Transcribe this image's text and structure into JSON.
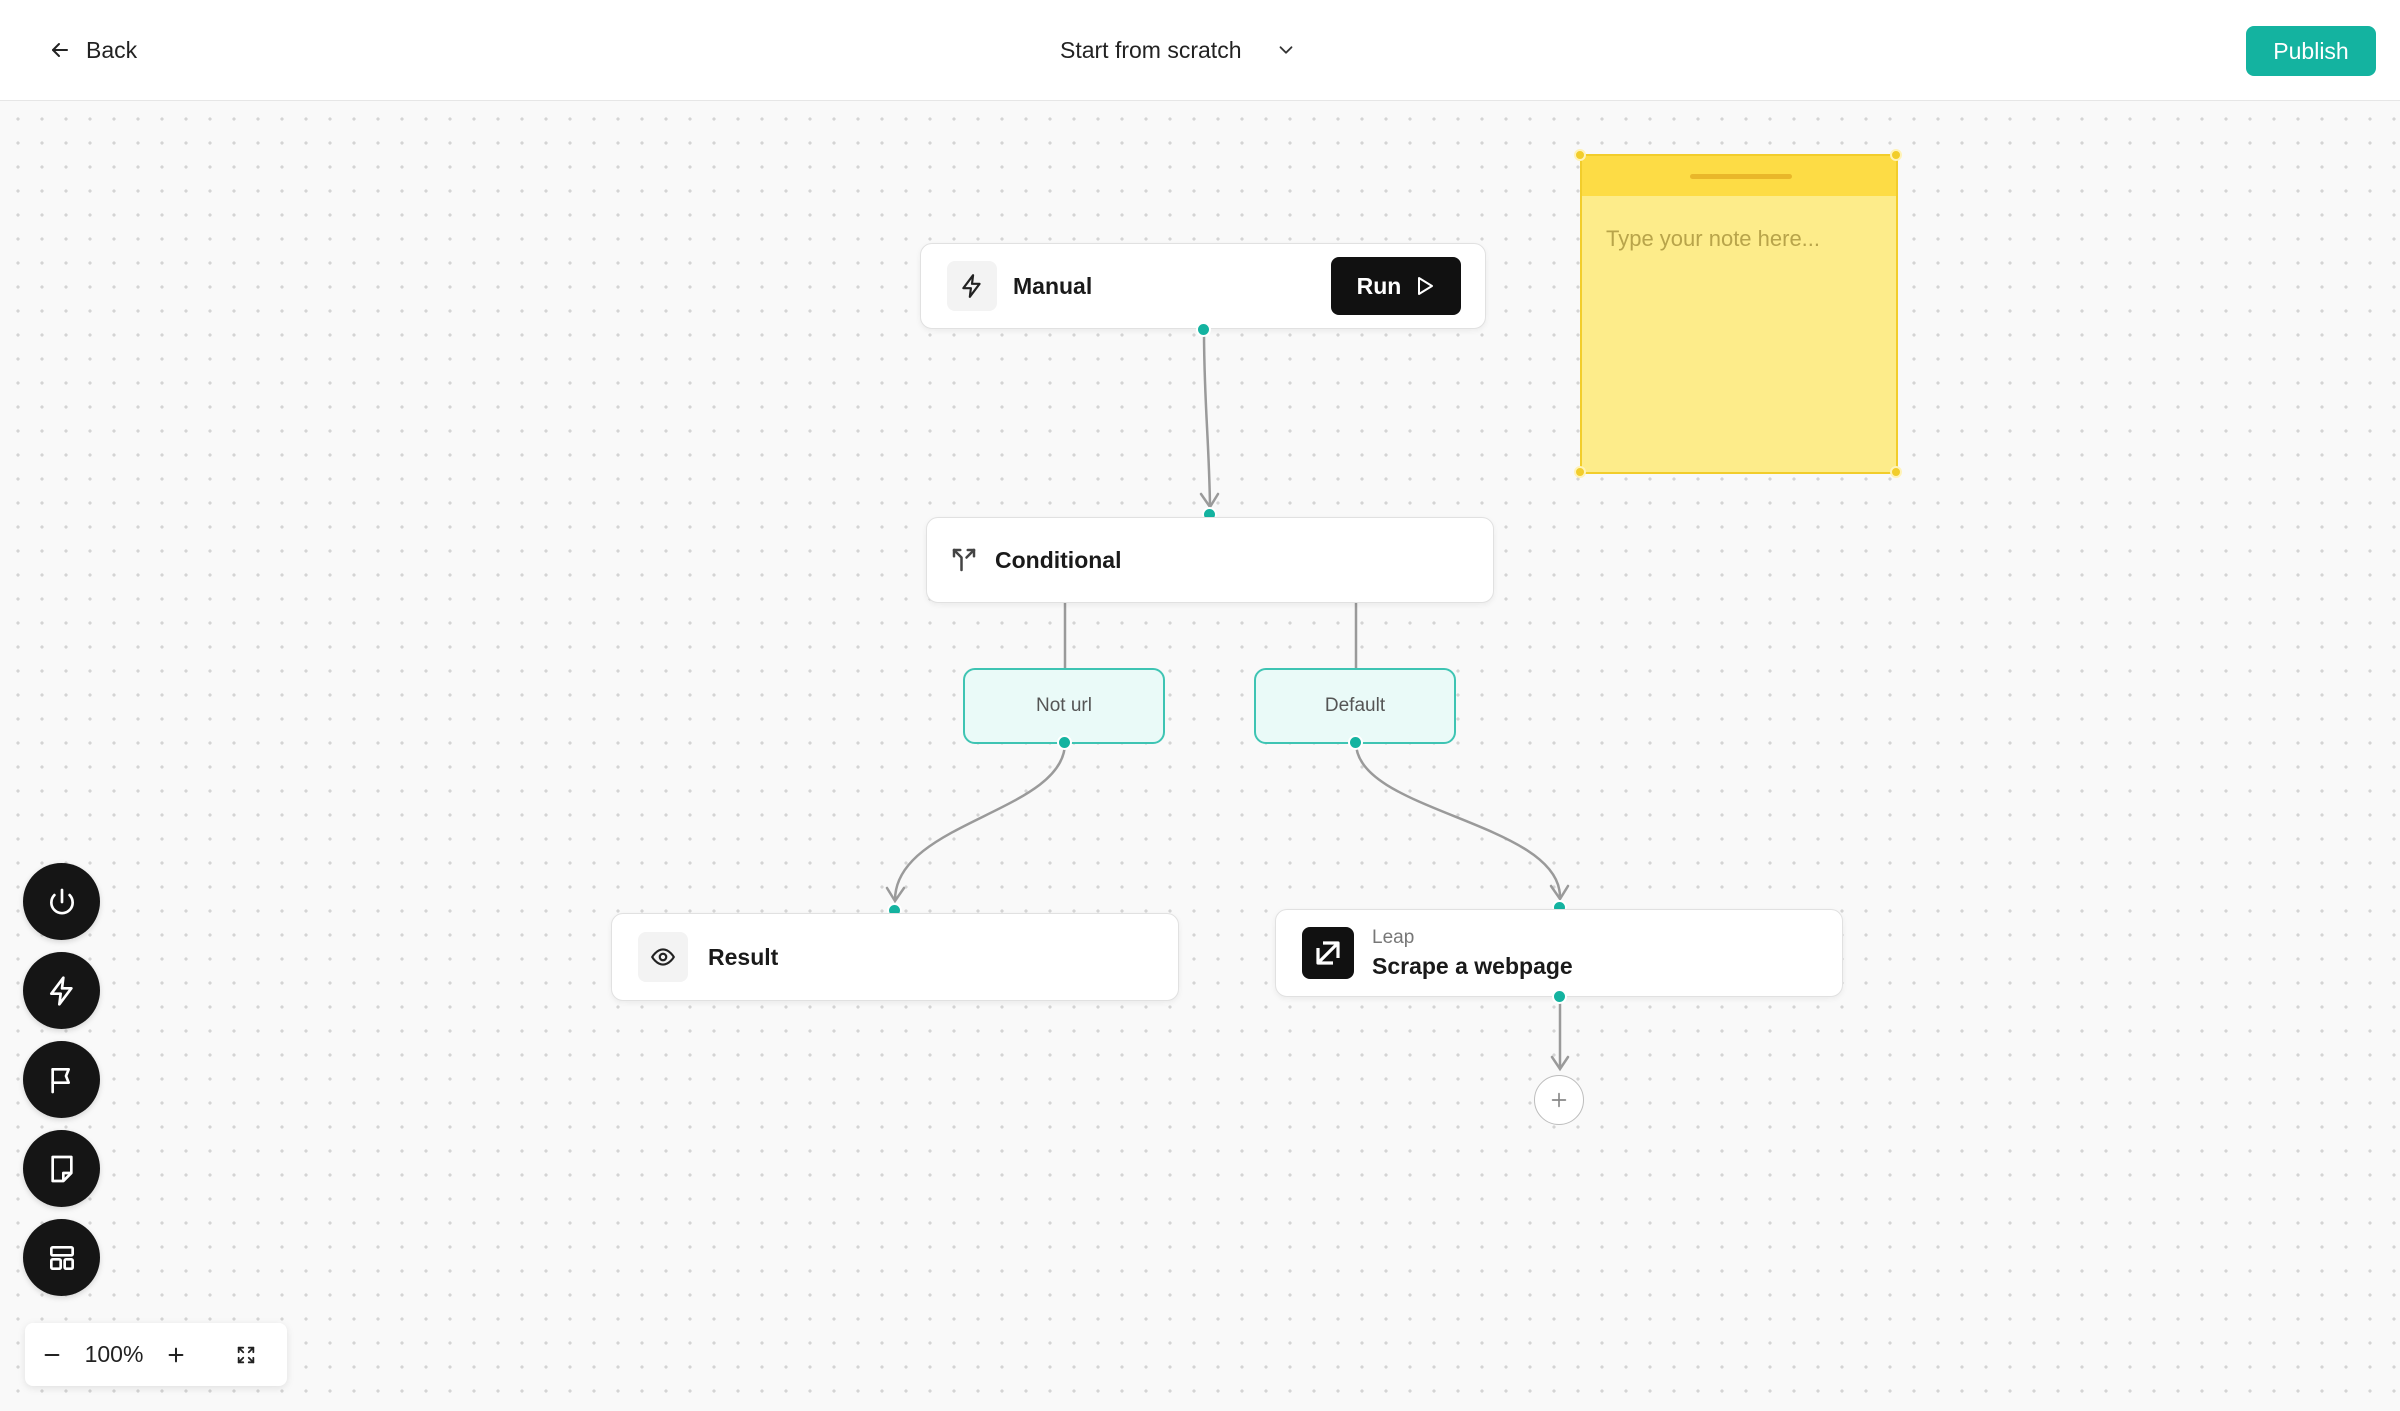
{
  "header": {
    "back_label": "Back",
    "title": "Start from scratch",
    "publish_label": "Publish"
  },
  "nodes": {
    "manual": {
      "label": "Manual",
      "run_label": "Run"
    },
    "conditional": {
      "label": "Conditional"
    },
    "branches": [
      {
        "label": "Not url"
      },
      {
        "label": "Default"
      }
    ],
    "result": {
      "label": "Result"
    },
    "leap": {
      "provider": "Leap",
      "label": "Scrape a webpage"
    }
  },
  "note": {
    "placeholder": "Type your note here..."
  },
  "zoom": {
    "level": "100%"
  },
  "toolbar": {
    "tools": [
      "power-icon",
      "bolt-icon",
      "flag-icon",
      "note-icon",
      "layout-icon"
    ]
  },
  "colors": {
    "accent": "#14b3a0",
    "note_bg": "#fdec8a",
    "note_bar": "#fddc45",
    "branch_bg": "#eafaf8"
  }
}
